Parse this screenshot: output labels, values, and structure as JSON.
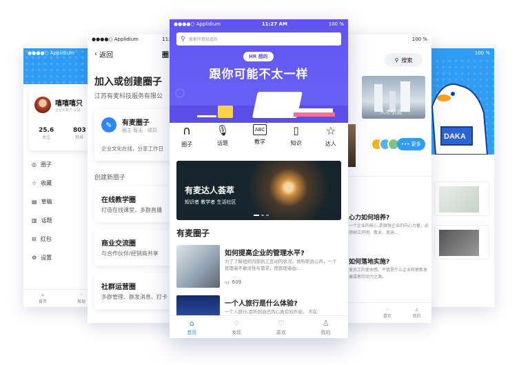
{
  "status": {
    "carrier": "●●●●○ Applidium",
    "time": "11:27 AM",
    "battery": "100 %"
  },
  "p1": {
    "name": "嘻嘻嘻只",
    "subtitle": "企业大客户 认证",
    "stats": [
      {
        "value": "25.6",
        "label": "关注"
      },
      {
        "value": "803",
        "label": "粉丝"
      }
    ],
    "menu": [
      "圈子",
      "收藏",
      "草稿",
      "话题",
      "红包",
      "设置"
    ],
    "tabs": [
      "首页",
      "发现"
    ]
  },
  "p2": {
    "back": "返回",
    "title_partial": "圈",
    "time": "11:2",
    "heading": "加入或创建圈子",
    "company": "江苏有麦科技服务有限公",
    "circle_name": "有麦圈子",
    "circle_meta": "圈主 智无 · 成员",
    "circle_desc": "企业文化在线，分享工作日",
    "create_label": "创建新圈子",
    "items": [
      {
        "title": "在线教学圈",
        "desc": "打造在线课堂，多群直播"
      },
      {
        "title": "商业交流圈",
        "desc": "与合作伙伴/经销商共享"
      },
      {
        "title": "社群运营圈",
        "desc": "多群管理、群发消息、打卡"
      }
    ]
  },
  "p3": {
    "search_placeholder": "搜索你想知道的",
    "badge": "HR 想的",
    "hero_title": "跟你可能不太一样",
    "categories": [
      {
        "label": "圈子",
        "icon": "headphones-icon"
      },
      {
        "label": "话题",
        "icon": "microphone-icon"
      },
      {
        "label": "教学",
        "icon": "abc-box-icon"
      },
      {
        "label": "知识",
        "icon": "book-icon"
      },
      {
        "label": "达人",
        "icon": "star-icon"
      }
    ],
    "banner_title": "有麦达人荟萃",
    "banner_sub": "知识者 教学者 生活社区",
    "section_title": "有麦圈子",
    "articles": [
      {
        "title": "如何提高企业的管理水平?",
        "desc": "为了了解组织内部员工互动的状况，倾听职员心声，一个管理者不敢没性与需求，而管理者由...",
        "comments": "609"
      },
      {
        "title": "一个人旅行是什么体验?",
        "desc": "一个人旅行,会听到自己内心真实的声音。 不在"
      }
    ],
    "tabs": [
      "首页",
      "发现",
      "喜欢",
      "我的"
    ]
  },
  "p4": {
    "search": "搜索",
    "card_label": "人才引流",
    "more": "••• 更多",
    "lines": [
      {
        "title": "心力如何培养?",
        "desc": "一个企业的核心,是继强企业的向心力量。必须树立开明、敬业、宽容..."
      },
      {
        "title": "如何落地实施?",
        "desc": "发员工的使命感。不管是什么企业和使新发展或者的动力之源。"
      }
    ],
    "tabs": [
      "喜欢",
      "我的"
    ]
  },
  "p5": {
    "mascot_text": "DAKA",
    "battery": "100 %"
  }
}
